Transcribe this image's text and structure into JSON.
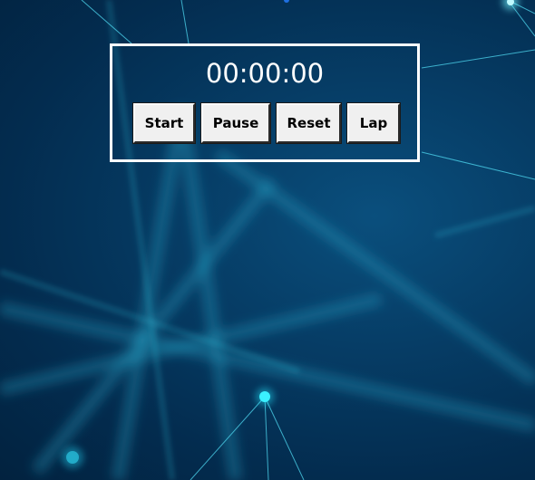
{
  "stopwatch": {
    "time": "00:00:00",
    "buttons": {
      "start": "Start",
      "pause": "Pause",
      "reset": "Reset",
      "lap": "Lap"
    }
  },
  "colors": {
    "background_dark": "#02223f",
    "background_mid": "#063d66",
    "line_glow": "#3ad6f0",
    "node": "#23e6ff",
    "panel_border": "#ffffff",
    "button_face": "#f0f0f0"
  },
  "background": {
    "style": "network-lines-wallpaper"
  }
}
